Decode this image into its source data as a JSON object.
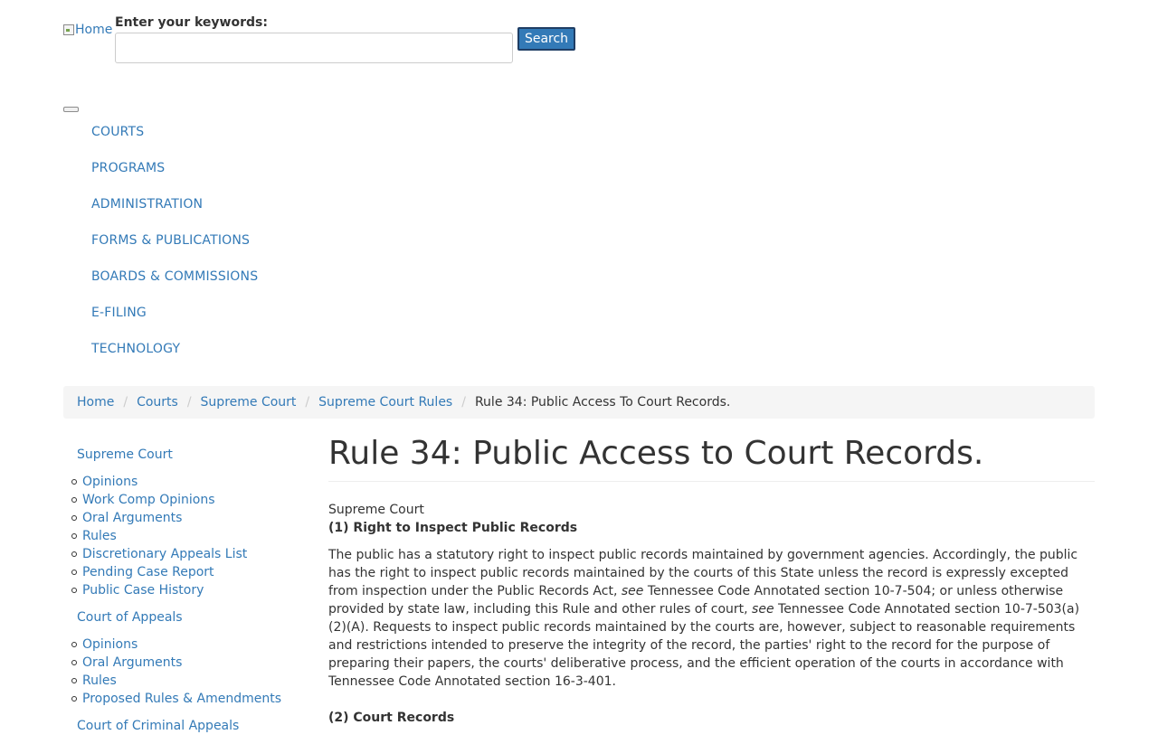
{
  "header": {
    "logo_alt": "Home",
    "search_label": "Enter your keywords:",
    "search_value": "",
    "search_button": "Search"
  },
  "nav": {
    "items": [
      {
        "label": "COURTS"
      },
      {
        "label": "PROGRAMS"
      },
      {
        "label": "ADMINISTRATION"
      },
      {
        "label": "FORMS & PUBLICATIONS"
      },
      {
        "label": "BOARDS & COMMISSIONS"
      },
      {
        "label": "E-FILING"
      },
      {
        "label": "TECHNOLOGY"
      }
    ]
  },
  "breadcrumb": {
    "items": [
      "Home",
      "Courts",
      "Supreme Court",
      "Supreme Court Rules"
    ],
    "current": "Rule 34: Public Access To Court Records."
  },
  "sidebar": {
    "groups": [
      {
        "heading": "Supreme Court",
        "items": [
          "Opinions",
          "Work Comp Opinions",
          "Oral Arguments",
          "Rules",
          "Discretionary Appeals List",
          "Pending Case Report",
          "Public Case History"
        ]
      },
      {
        "heading": "Court of Appeals",
        "items": [
          "Opinions",
          "Oral Arguments",
          "Rules",
          "Proposed Rules & Amendments"
        ]
      },
      {
        "heading": "Court of Criminal Appeals",
        "items": []
      }
    ]
  },
  "content": {
    "title": "Rule 34: Public Access to Court Records.",
    "court": "Supreme Court",
    "section1_heading": "(1) Right to Inspect Public Records",
    "para1": {
      "part1": "The public has a statutory right to inspect public records maintained by government agencies. Accordingly, the public has the right to inspect public records maintained by the courts of this State unless the record is expressly excepted from inspection under the Public Records Act, ",
      "see1": "see",
      "part2": " Tennessee Code Annotated section 10-7-504; or unless otherwise provided by state law, including this Rule and other rules of court, ",
      "see2": "see",
      "part3": " Tennessee Code Annotated section 10-7-503(a)(2)(A). Requests to inspect public records maintained by the courts are, however, subject to reasonable requirements and restrictions intended to preserve the integrity of the record, the parties' right to the record for the purpose of preparing their papers, the courts' deliberative process, and the efficient operation of the courts in accordance with Tennessee Code Annotated section 16-3-401."
    },
    "section2_heading": "(2) Court Records"
  }
}
